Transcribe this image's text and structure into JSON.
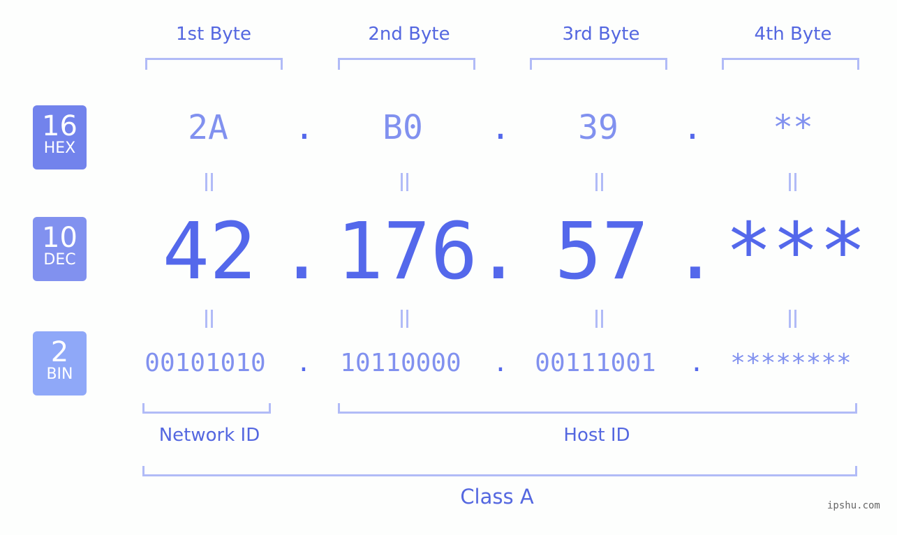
{
  "headers": [
    "1st Byte",
    "2nd Byte",
    "3rd Byte",
    "4th Byte"
  ],
  "badges": [
    {
      "num": "16",
      "label": "HEX",
      "color": "#7283ec"
    },
    {
      "num": "10",
      "label": "DEC",
      "color": "#8191ef"
    },
    {
      "num": "2",
      "label": "BIN",
      "color": "#8fa8f8"
    }
  ],
  "hex": [
    "2A",
    "B0",
    "39",
    "**"
  ],
  "dec": [
    "42",
    "176",
    "57",
    "***"
  ],
  "bin": [
    "00101010",
    "10110000",
    "00111001",
    "********"
  ],
  "separator": ".",
  "network_label": "Network ID",
  "host_label": "Host ID",
  "class_label": "Class A",
  "watermark": "ipshu.com",
  "colors": {
    "accent": "#5468eb",
    "light": "#8191ef",
    "bracket": "#b1bbf7"
  }
}
